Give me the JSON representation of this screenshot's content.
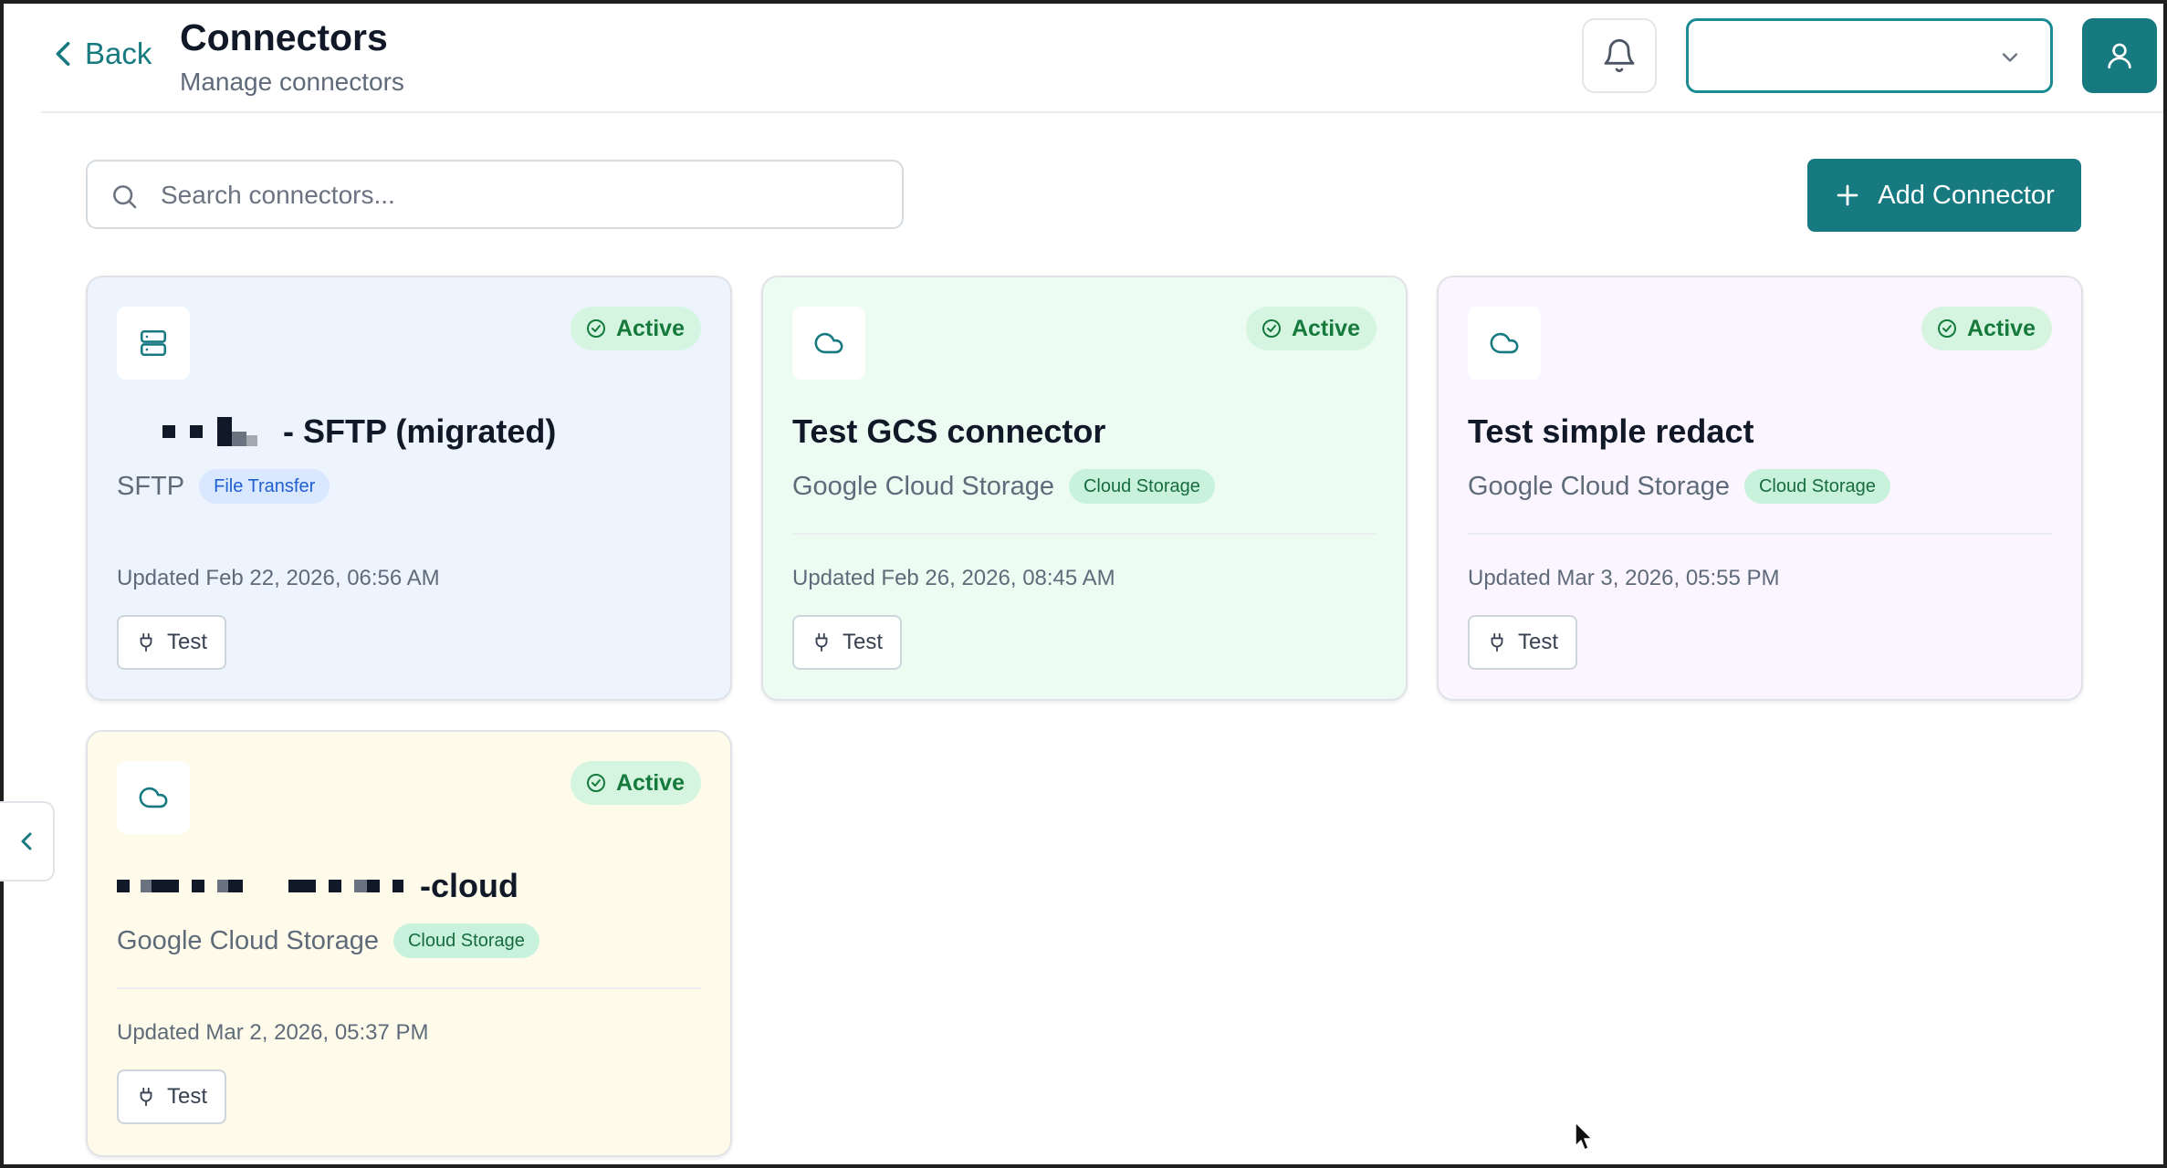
{
  "header": {
    "back_label": "Back",
    "title": "Connectors",
    "subtitle": "Manage connectors",
    "notification_icon": "bell-icon",
    "workspace_select_value": "",
    "user_icon": "user-icon"
  },
  "toolbar": {
    "search_placeholder": "Search connectors...",
    "search_value": "",
    "add_label": "Add Connector"
  },
  "colors": {
    "accent": "#167a80",
    "active_badge_bg": "#d6f5e1",
    "active_badge_text": "#157a3b"
  },
  "connectors": [
    {
      "name": "- SFTP (migrated)",
      "type": "SFTP",
      "category": "File Transfer",
      "status": "Active",
      "updated": "Updated Feb 22, 2026, 06:56 AM",
      "icon": "server-icon",
      "test_label": "Test"
    },
    {
      "name": "Test GCS connector",
      "type": "Google Cloud Storage",
      "category": "Cloud Storage",
      "status": "Active",
      "updated": "Updated Feb 26, 2026, 08:45 AM",
      "icon": "cloud-icon",
      "test_label": "Test"
    },
    {
      "name": "Test simple redact",
      "type": "Google Cloud Storage",
      "category": "Cloud Storage",
      "status": "Active",
      "updated": "Updated Mar 3, 2026, 05:55 PM",
      "icon": "cloud-icon",
      "test_label": "Test"
    },
    {
      "name": "-cloud",
      "type": "Google Cloud Storage",
      "category": "Cloud Storage",
      "status": "Active",
      "updated": "Updated Mar 2, 2026, 05:37 PM",
      "icon": "cloud-icon",
      "test_label": "Test"
    }
  ]
}
